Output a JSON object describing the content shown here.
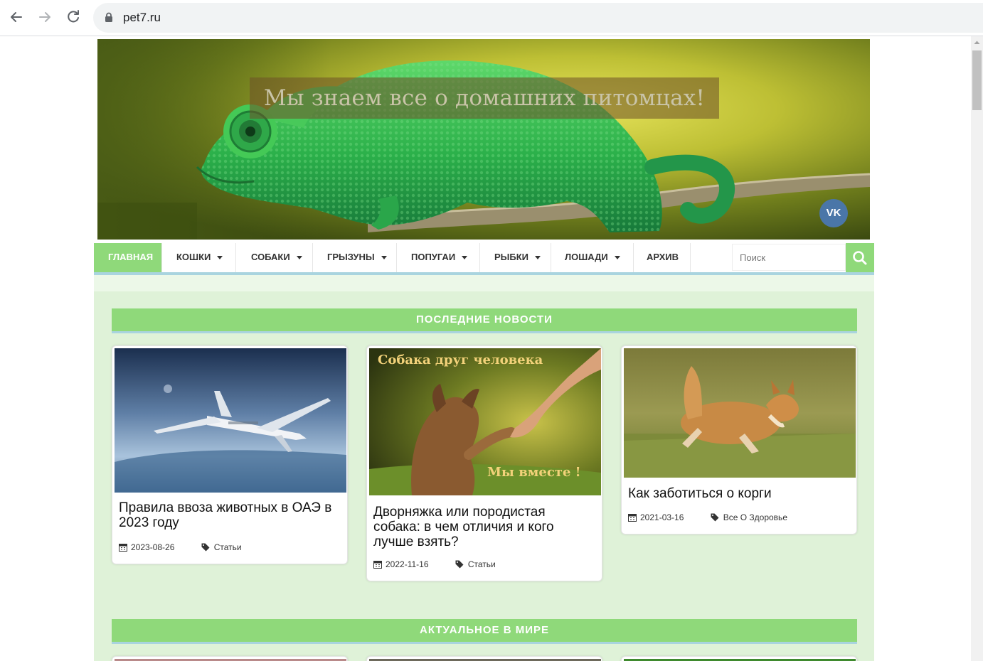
{
  "browser": {
    "url": "pet7.ru"
  },
  "header": {
    "tagline": "Мы знаем все о домашних питомцах!",
    "vk_label": "VK"
  },
  "menu": {
    "items": [
      {
        "label": "Главная",
        "has_dropdown": false,
        "active": true
      },
      {
        "label": "Кошки",
        "has_dropdown": true,
        "active": false
      },
      {
        "label": "Собаки",
        "has_dropdown": true,
        "active": false
      },
      {
        "label": "Грызуны",
        "has_dropdown": true,
        "active": false
      },
      {
        "label": "Попугаи",
        "has_dropdown": true,
        "active": false
      },
      {
        "label": "Рыбки",
        "has_dropdown": true,
        "active": false
      },
      {
        "label": "Лошади",
        "has_dropdown": true,
        "active": false
      },
      {
        "label": "Архив",
        "has_dropdown": false,
        "active": false
      }
    ],
    "search_placeholder": "Поиск"
  },
  "sections": [
    {
      "title": "ПОСЛЕДНИЕ НОВОСТИ",
      "cards": [
        {
          "title": "Правила ввоза животных в ОАЭ в 2023 году",
          "date": "2023-08-26",
          "category": "Статьи",
          "image": "airplane"
        },
        {
          "title": "Дворняжка или породистая собака: в чем отличия и кого лучше взять?",
          "date": "2022-11-16",
          "category": "Статьи",
          "image": "dog-hand",
          "image_caption_top": "Собака друг человека",
          "image_caption_bottom": "Мы вместе !"
        },
        {
          "title": "Как заботиться о корги",
          "date": "2021-03-16",
          "category": "Все О Здоровье",
          "image": "corgi"
        }
      ]
    },
    {
      "title": "АКТУАЛЬНОЕ В МИРЕ"
    }
  ],
  "colors": {
    "accent_green": "#8fd97a",
    "page_bg": "#dff2d8",
    "underline_blue": "#a9d4df",
    "vk_blue": "#4a76a8"
  }
}
